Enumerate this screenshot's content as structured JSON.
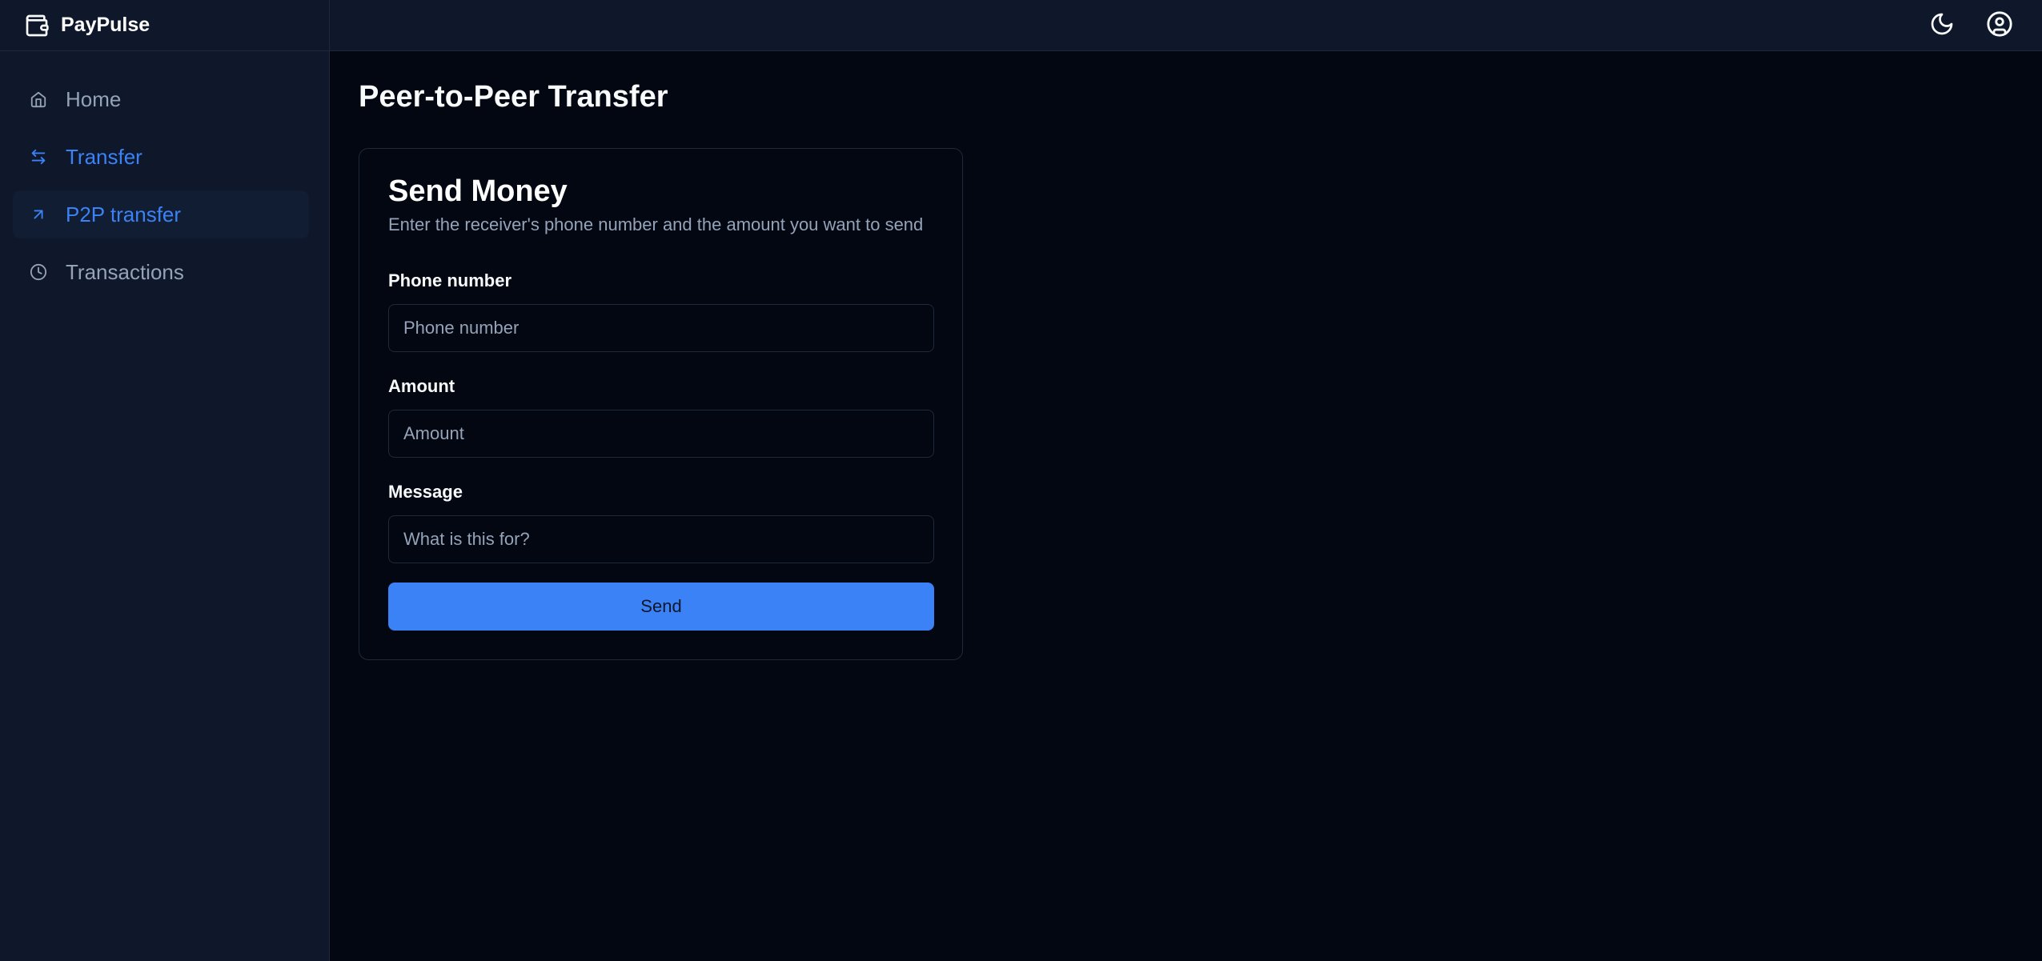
{
  "app": {
    "brand": "PayPulse",
    "brand_icon": "wallet-icon"
  },
  "sidebar": {
    "items": [
      {
        "label": "Home",
        "icon": "home-icon",
        "active": false
      },
      {
        "label": "Transfer",
        "icon": "arrows-left-right-icon",
        "active": true
      },
      {
        "label": "P2P transfer",
        "icon": "arrow-up-right-icon",
        "active": true
      },
      {
        "label": "Transactions",
        "icon": "clock-icon",
        "active": false
      }
    ]
  },
  "header": {
    "theme_toggle_icon": "moon-icon",
    "profile_icon": "user-circle-icon"
  },
  "main": {
    "title": "Peer-to-Peer Transfer",
    "card": {
      "title": "Send Money",
      "description": "Enter the receiver's phone number and the amount you want to send",
      "fields": {
        "phone": {
          "label": "Phone number",
          "placeholder": "Phone number",
          "value": ""
        },
        "amount": {
          "label": "Amount",
          "placeholder": "Amount",
          "value": ""
        },
        "message": {
          "label": "Message",
          "placeholder": "What is this for?",
          "value": ""
        }
      },
      "submit_label": "Send"
    }
  },
  "colors": {
    "accent": "#3b82f6",
    "background": "#030712",
    "sidebar": "#0f172a",
    "muted_text": "#94a3b8",
    "border": "#1e293b"
  }
}
